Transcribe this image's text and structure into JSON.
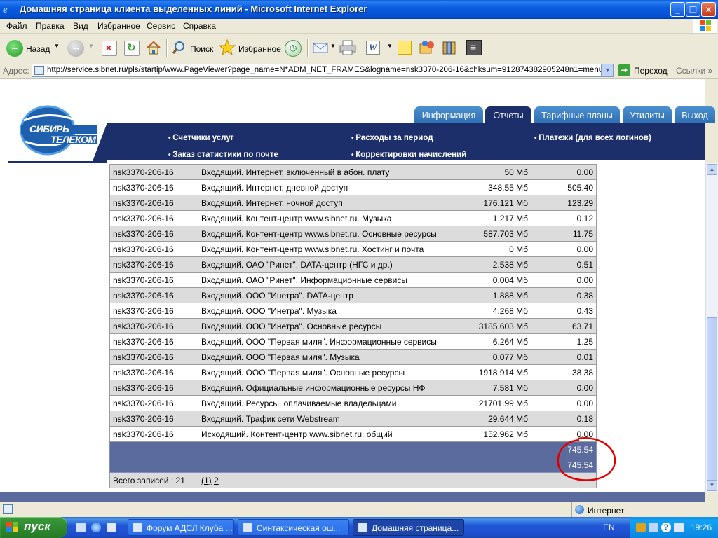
{
  "window": {
    "title": "Домашняя страница клиента выделенных линий - Microsoft Internet Explorer",
    "controls": [
      "_",
      "❐",
      "✕"
    ]
  },
  "menu": [
    "Файл",
    "Правка",
    "Вид",
    "Избранное",
    "Сервис",
    "Справка"
  ],
  "toolbar": {
    "back": "Назад",
    "search": "Поиск",
    "favorites": "Избранное"
  },
  "address": {
    "label": "Адрес:",
    "url": "http://service.sibnet.ru/pls/startip/www.PageViewer?page_name=N*ADM_NET_FRAMES&logname=nsk3370-206-16&chksum=912874382905248n1=menu&v1=N*",
    "go": "Переход",
    "links": "Ссылки"
  },
  "site": {
    "logo_line1": "СИБИРЬ",
    "logo_line2": "ТЕЛЕКОМ",
    "tabs": [
      {
        "label": "Информация",
        "active": false
      },
      {
        "label": "Отчеты",
        "active": true
      },
      {
        "label": "Тарифные планы",
        "active": false
      },
      {
        "label": "Утилиты",
        "active": false
      },
      {
        "label": "Выход",
        "active": false
      }
    ],
    "nav": [
      "Счетчики услуг",
      "Расходы за период",
      "Платежи (для всех логинов)",
      "Заказ статистики по почте",
      "Корректировки начислений"
    ]
  },
  "table": {
    "rows": [
      [
        "nsk3370-206-16",
        "Входящий. Интернет, включенный в абон. плату",
        "50 Мб",
        "0.00"
      ],
      [
        "nsk3370-206-16",
        "Входящий. Интернет, дневной доступ",
        "348.55 Мб",
        "505.40"
      ],
      [
        "nsk3370-206-16",
        "Входящий. Интернет, ночной доступ",
        "176.121 Мб",
        "123.29"
      ],
      [
        "nsk3370-206-16",
        "Входящий. Контент-центр www.sibnet.ru. Музыка",
        "1.217 Мб",
        "0.12"
      ],
      [
        "nsk3370-206-16",
        "Входящий. Контент-центр www.sibnet.ru. Основные ресурсы",
        "587.703 Мб",
        "11.75"
      ],
      [
        "nsk3370-206-16",
        "Входящий. Контент-центр www.sibnet.ru. Хостинг и почта",
        "0 Мб",
        "0.00"
      ],
      [
        "nsk3370-206-16",
        "Входящий. ОАО \"Ринет\". DATA-центр (НГС и др.)",
        "2.538 Мб",
        "0.51"
      ],
      [
        "nsk3370-206-16",
        "Входящий. ОАО \"Ринет\". Информационные сервисы",
        "0.004 Мб",
        "0.00"
      ],
      [
        "nsk3370-206-16",
        "Входящий. ООО \"Инетра\". DATA-центр",
        "1.888 Мб",
        "0.38"
      ],
      [
        "nsk3370-206-16",
        "Входящий. ООО \"Инетра\". Музыка",
        "4.268 Мб",
        "0.43"
      ],
      [
        "nsk3370-206-16",
        "Входящий. ООО \"Инетра\". Основные ресурсы",
        "3185.603 Мб",
        "63.71"
      ],
      [
        "nsk3370-206-16",
        "Входящий. ООО \"Первая миля\". Информационные сервисы",
        "6.264 Мб",
        "1.25"
      ],
      [
        "nsk3370-206-16",
        "Входящий. ООО \"Первая миля\". Музыка",
        "0.077 Мб",
        "0.01"
      ],
      [
        "nsk3370-206-16",
        "Входящий. ООО \"Первая миля\". Основные ресурсы",
        "1918.914 Мб",
        "38.38"
      ],
      [
        "nsk3370-206-16",
        "Входящий. Официальные информационные ресурсы НФ",
        "7.581 Мб",
        "0.00"
      ],
      [
        "nsk3370-206-16",
        "Входящий. Ресурсы, оплачиваемые владельцами",
        "21701.99 Мб",
        "0.00"
      ],
      [
        "nsk3370-206-16",
        "Входящий. Трафик сети Webstream",
        "29.644 Мб",
        "0.18"
      ],
      [
        "nsk3370-206-16",
        "Исходящий. Контент-центр www.sibnet.ru. общий",
        "152.962 Мб",
        "0.00"
      ]
    ],
    "totals": [
      "745.54",
      "745.54"
    ],
    "footer_count": "Всего записей : 21",
    "pages": [
      "(1)",
      "2"
    ]
  },
  "statusbar": {
    "zone": "Интернет"
  },
  "taskbar": {
    "start": "пуск",
    "tasks": [
      {
        "label": "Форум АДСЛ Клуба ...",
        "active": false
      },
      {
        "label": "Синтаксическая ош...",
        "active": false
      },
      {
        "label": "Домашняя страница...",
        "active": true
      }
    ],
    "lang": "EN",
    "clock": "19:26"
  },
  "colors": {
    "nav_blue": "#1c2f6a",
    "tab_blue": "#2f6fb3",
    "totals_row": "#5b6b9d",
    "annotation_red": "#e00000"
  }
}
